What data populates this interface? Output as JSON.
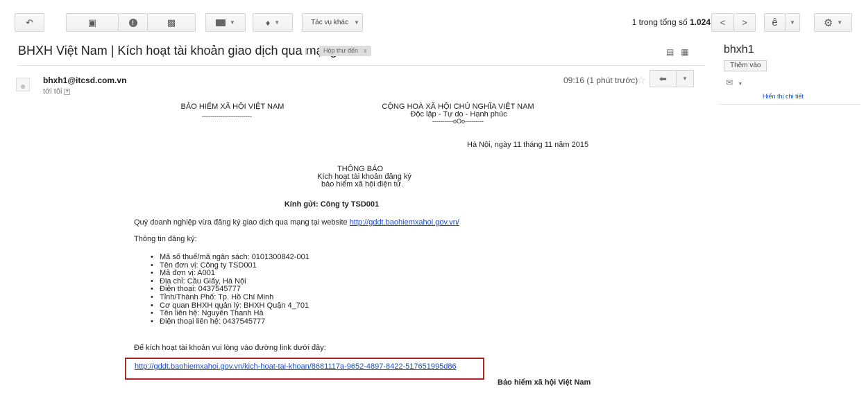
{
  "toolbar": {
    "back_icon": "arrow-left-icon",
    "archive_icon": "archive-icon",
    "spam_icon": "report-spam-icon",
    "delete_icon": "trash-icon",
    "move_icon": "folder-icon",
    "label_icon": "label-tag-icon",
    "more_actions_label": "Tác vụ khác",
    "pager_prefix": "1 trong tổng số ",
    "pager_total": "1.024",
    "prev_icon": "chevron-left-icon",
    "next_icon": "chevron-right-icon",
    "input_tool_label": "ê",
    "settings_icon": "gear-icon"
  },
  "email": {
    "subject": "BHXH Việt Nam | Kích hoạt tài khoản giao dịch qua mạng",
    "label": "Hộp thư đến",
    "label_remove": "x",
    "sender": "bhxh1@itcsd.com.vn",
    "to_me": "tới tôi",
    "time": "09:16 (1 phút trước)"
  },
  "side": {
    "name": "bhxh1",
    "add_button": "Thêm vào",
    "details_link": "Hiển thị chi tiết"
  },
  "letter": {
    "org": "BẢO HIỂM XÃ HỘI VIỆT NAM",
    "org_line": "------------------------",
    "republic": "CỘNG HOÀ XÃ HỘI CHỦ NGHĨA VIỆT NAM",
    "motto": "Độc lập - Tự do - Hạnh phúc",
    "motto_line": "----------oOo---------",
    "date": "Hà Nội, ngày 11 tháng 11 năm 2015",
    "title": "THÔNG BÁO",
    "subtitle1": "Kích hoạt tài khoản đăng ký",
    "subtitle2": "bảo hiểm xã hội điện tử.",
    "greeting": "Kính gửi: Công ty TSD001",
    "intro": "Quý doanh nghiệp vừa đăng ký giao dịch qua mạng tại website ",
    "intro_link": "http://gddt.baohiemxahoi.gov.vn/",
    "info_heading": "Thông tin đăng ký:",
    "info": [
      "Mã số thuế/mã ngân sách: 0101300842-001",
      "Tên đơn vị: Công ty TSD001",
      "Mã đơn vị: A001",
      "Địa chỉ: Cầu Giấy, Hà Nội",
      "Điện thoại: 0437545777",
      "Tỉnh/Thành Phố: Tp. Hồ Chí Minh",
      "Cơ quan BHXH quản lý: BHXH Quận 4_701",
      "Tên liên hệ: Nguyễn Thanh Hà",
      "Điện thoại liên hệ: 0437545777"
    ],
    "activate_text": "Để kích hoạt tài khoản vui lòng vào đường link dưới đây:",
    "activate_link": "http://gddt.baohiemxahoi.gov.vn/kich-hoat-tai-khoan/8681117a-9652-4897-8422-517651995d86",
    "signature": "Bảo hiểm xã hội Việt Nam"
  }
}
